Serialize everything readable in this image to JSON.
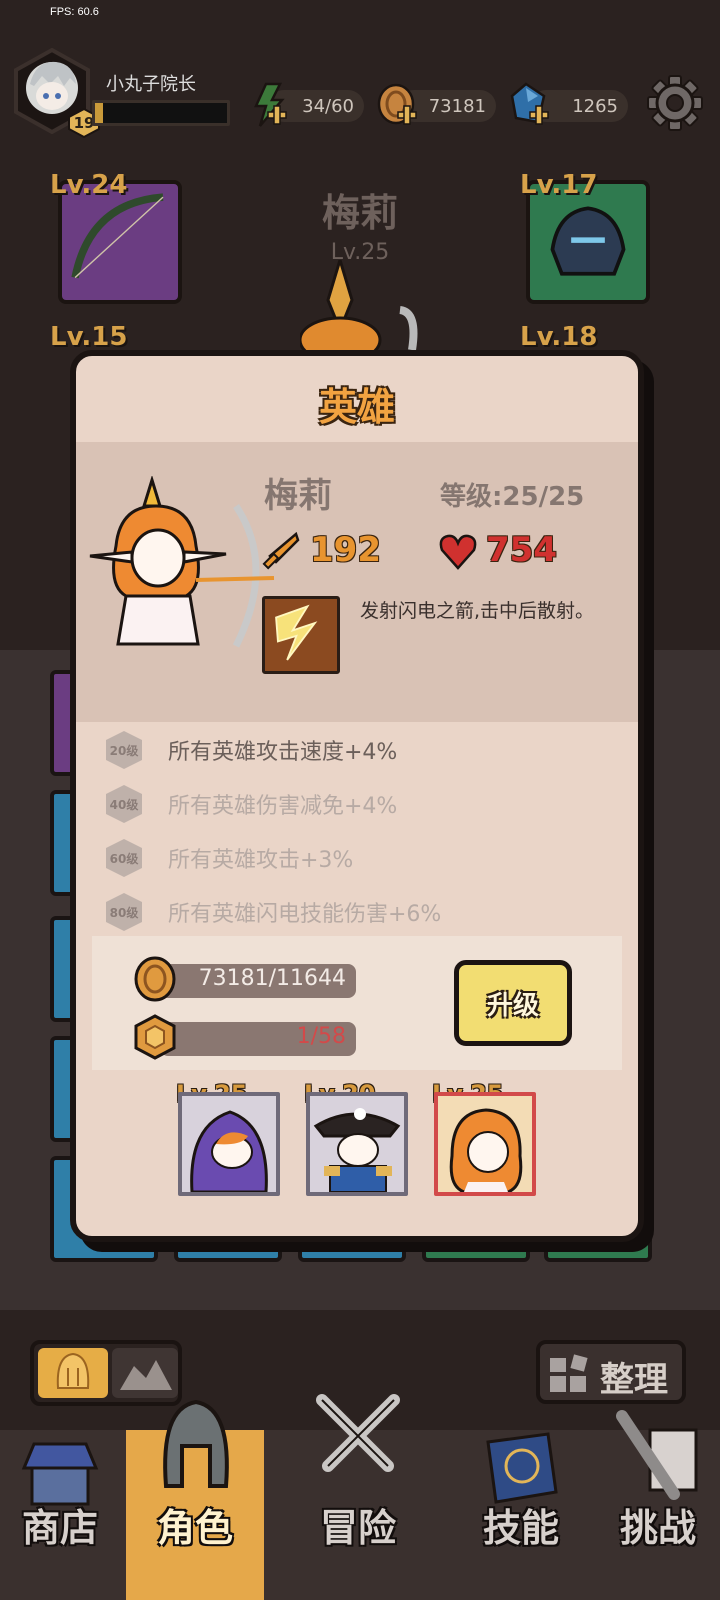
{
  "fps": "FPS: 60.6",
  "player": {
    "name": "小丸子院长",
    "level": "19",
    "exp_fraction": 0.06
  },
  "resources": {
    "energy": "34/60",
    "coins": "73181",
    "gems": "1265"
  },
  "background_hero": {
    "name": "梅莉",
    "level": "Lv.25"
  },
  "equipment_levels": {
    "top_left": "Lv.24",
    "top_right": "Lv.17",
    "mid_left": "Lv.15",
    "mid_right": "Lv.18"
  },
  "modal": {
    "title": "英雄",
    "hero_name": "梅莉",
    "grade": "等级:25/25",
    "attack": "192",
    "hp": "754",
    "skill_desc": "发射闪电之箭,击中后散射。",
    "bonuses": [
      {
        "level": "20级",
        "text": "所有英雄攻击速度+4%",
        "active": true
      },
      {
        "level": "40级",
        "text": "所有英雄伤害减免+4%",
        "active": false
      },
      {
        "level": "60级",
        "text": "所有英雄攻击+3%",
        "active": false
      },
      {
        "level": "80级",
        "text": "所有英雄闪电技能伤害+6%",
        "active": false
      }
    ],
    "cost_coins": "73181/11644",
    "cost_shards": "1/58",
    "upgrade_label": "升级",
    "team": [
      {
        "level": "Lv.25",
        "name": "hooded-mage"
      },
      {
        "level": "Lv.20",
        "name": "pirate-captain"
      },
      {
        "level": "Lv.25",
        "name": "elf-archer"
      }
    ]
  },
  "sort_label": "整理",
  "nav": [
    {
      "label": "商店",
      "icon": "shop-icon"
    },
    {
      "label": "角色",
      "icon": "helmet-icon",
      "active": true
    },
    {
      "label": "冒险",
      "icon": "crossed-swords-icon"
    },
    {
      "label": "技能",
      "icon": "spellbook-icon"
    },
    {
      "label": "挑战",
      "icon": "sword-scroll-icon"
    }
  ],
  "colors": {
    "accent": "#e5a84a",
    "attack": "#e8942f",
    "hp": "#d0312f",
    "shard_text": "#d24a4a"
  }
}
